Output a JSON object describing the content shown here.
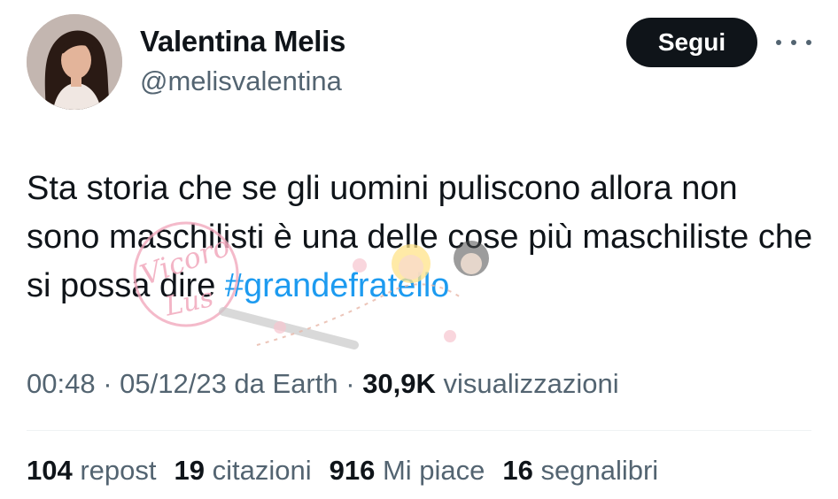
{
  "author": {
    "name": "Valentina Melis",
    "handle": "@melisvalentina",
    "follow_label": "Segui",
    "more_icon": "more-horizontal-icon"
  },
  "tweet": {
    "text": "Sta storia che se gli uomini puliscono allora non sono maschilisti è una delle cose più maschiliste che si possa dire ",
    "hashtag": "#grandefratello"
  },
  "meta": {
    "time": "00:48",
    "sep1": " · ",
    "date": "05/12/23",
    "source": " da Earth",
    "sep2": " · ",
    "views_count": "30,9K",
    "views_label": " visualizzazioni"
  },
  "stats": [
    {
      "count": "104",
      "label": " repost"
    },
    {
      "count": "19",
      "label": " citazioni"
    },
    {
      "count": "916",
      "label": " Mi piace"
    },
    {
      "count": "16",
      "label": " segnalibri"
    }
  ],
  "watermark": {
    "text": "Vicoro Lus"
  },
  "colors": {
    "link": "#1d9bf0",
    "muted": "#536471",
    "text": "#0f1419",
    "button_bg": "#0f1419"
  }
}
